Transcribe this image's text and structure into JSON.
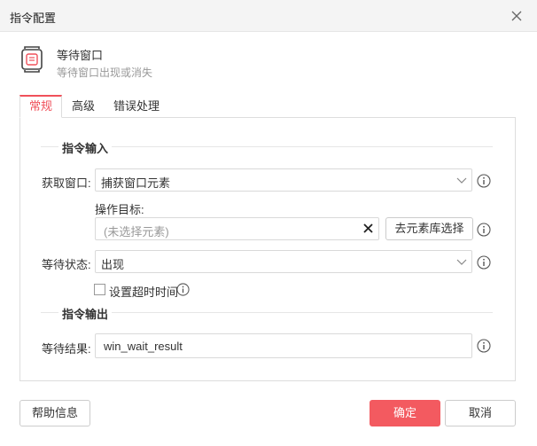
{
  "dialog": {
    "title": "指令配置"
  },
  "command": {
    "name": "等待窗口",
    "description": "等待窗口出现或消失"
  },
  "tabs": [
    {
      "label": "常规",
      "active": true
    },
    {
      "label": "高级",
      "active": false
    },
    {
      "label": "错误处理",
      "active": false
    }
  ],
  "input_section": {
    "title": "指令输入",
    "get_window": {
      "label": "获取窗口:",
      "value": "捕获窗口元素"
    },
    "target": {
      "label": "操作目标:",
      "placeholder": "(未选择元素)",
      "pick_button": "去元素库选择"
    },
    "wait_state": {
      "label": "等待状态:",
      "value": "出现"
    },
    "timeout": {
      "label": "设置超时时间",
      "checked": false
    }
  },
  "output_section": {
    "title": "指令输出",
    "result": {
      "label": "等待结果:",
      "value": "win_wait_result"
    }
  },
  "footer": {
    "help": "帮助信息",
    "ok": "确定",
    "cancel": "取消"
  },
  "colors": {
    "accent": "#f35a60",
    "tab_active": "#f0505a"
  }
}
